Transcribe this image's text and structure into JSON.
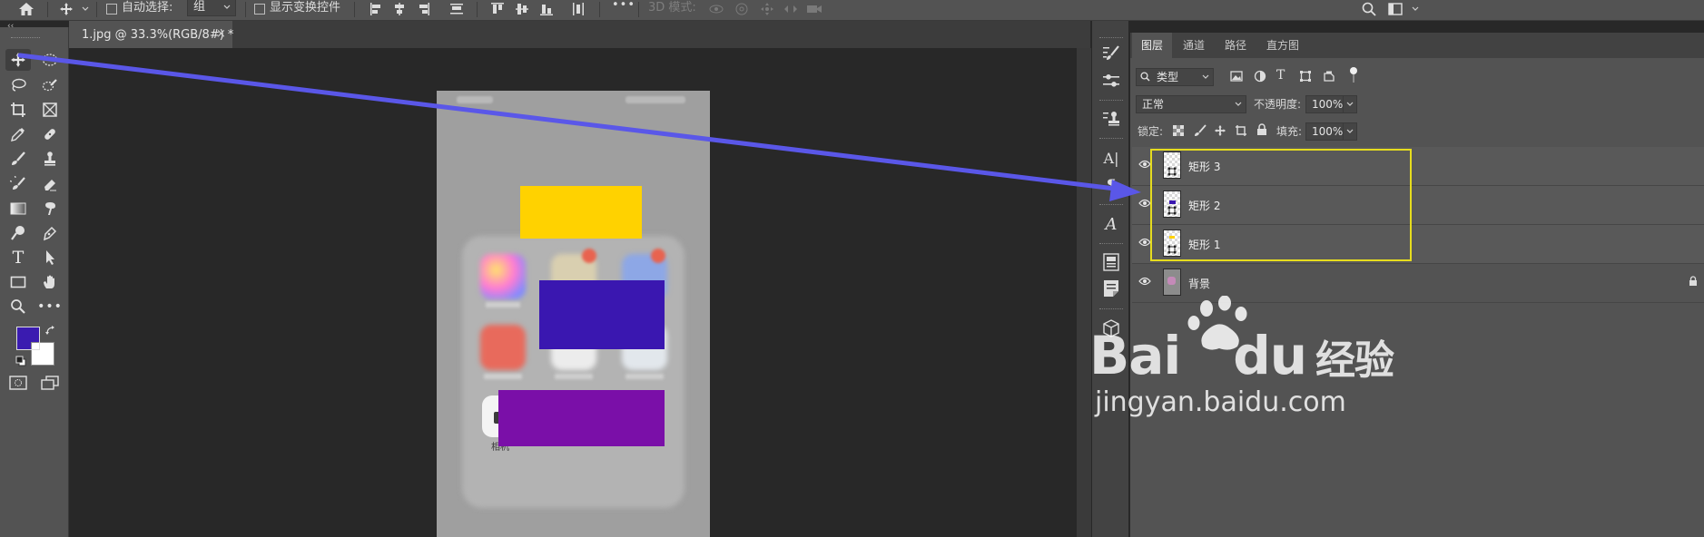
{
  "options_bar": {
    "auto_select_label": "自动选择:",
    "auto_select_value": "组",
    "show_transform_label": "显示变换控件",
    "more_label": "•••",
    "mode_3d_label": "3D 模式:"
  },
  "document": {
    "tab_title": "1.jpg @ 33.3%(RGB/8#) *",
    "close_glyph": "×",
    "app_label": "相机"
  },
  "tools": {
    "more_glyph": "•••",
    "type_glyph": "T",
    "foreground_color": "#3a1bb0",
    "background_color": "#ffffff"
  },
  "shapes": {
    "yellow": "#ffd200",
    "blue": "#3a17b0",
    "purple": "#7a0fa8"
  },
  "annotation": {
    "arrow_color": "#5a57e8"
  },
  "panel": {
    "tabs": [
      "图层",
      "通道",
      "路径",
      "直方图"
    ],
    "filter_label": "类型",
    "blend_mode": "正常",
    "opacity_label": "不透明度:",
    "opacity_value": "100%",
    "lock_label": "锁定:",
    "fill_label": "填充:",
    "fill_value": "100%",
    "highlight_color": "#e6dc1e",
    "layers": [
      {
        "name": "矩形 3"
      },
      {
        "name": "矩形 2"
      },
      {
        "name": "矩形 1"
      },
      {
        "name": "背景"
      }
    ]
  },
  "dock": {
    "char_glyph": "A|",
    "glyph_style": "A"
  },
  "watermark": {
    "brand": "Bai",
    "brand_tail": "du",
    "brand_cn": "经验",
    "url": "jingyan.baidu.com"
  }
}
